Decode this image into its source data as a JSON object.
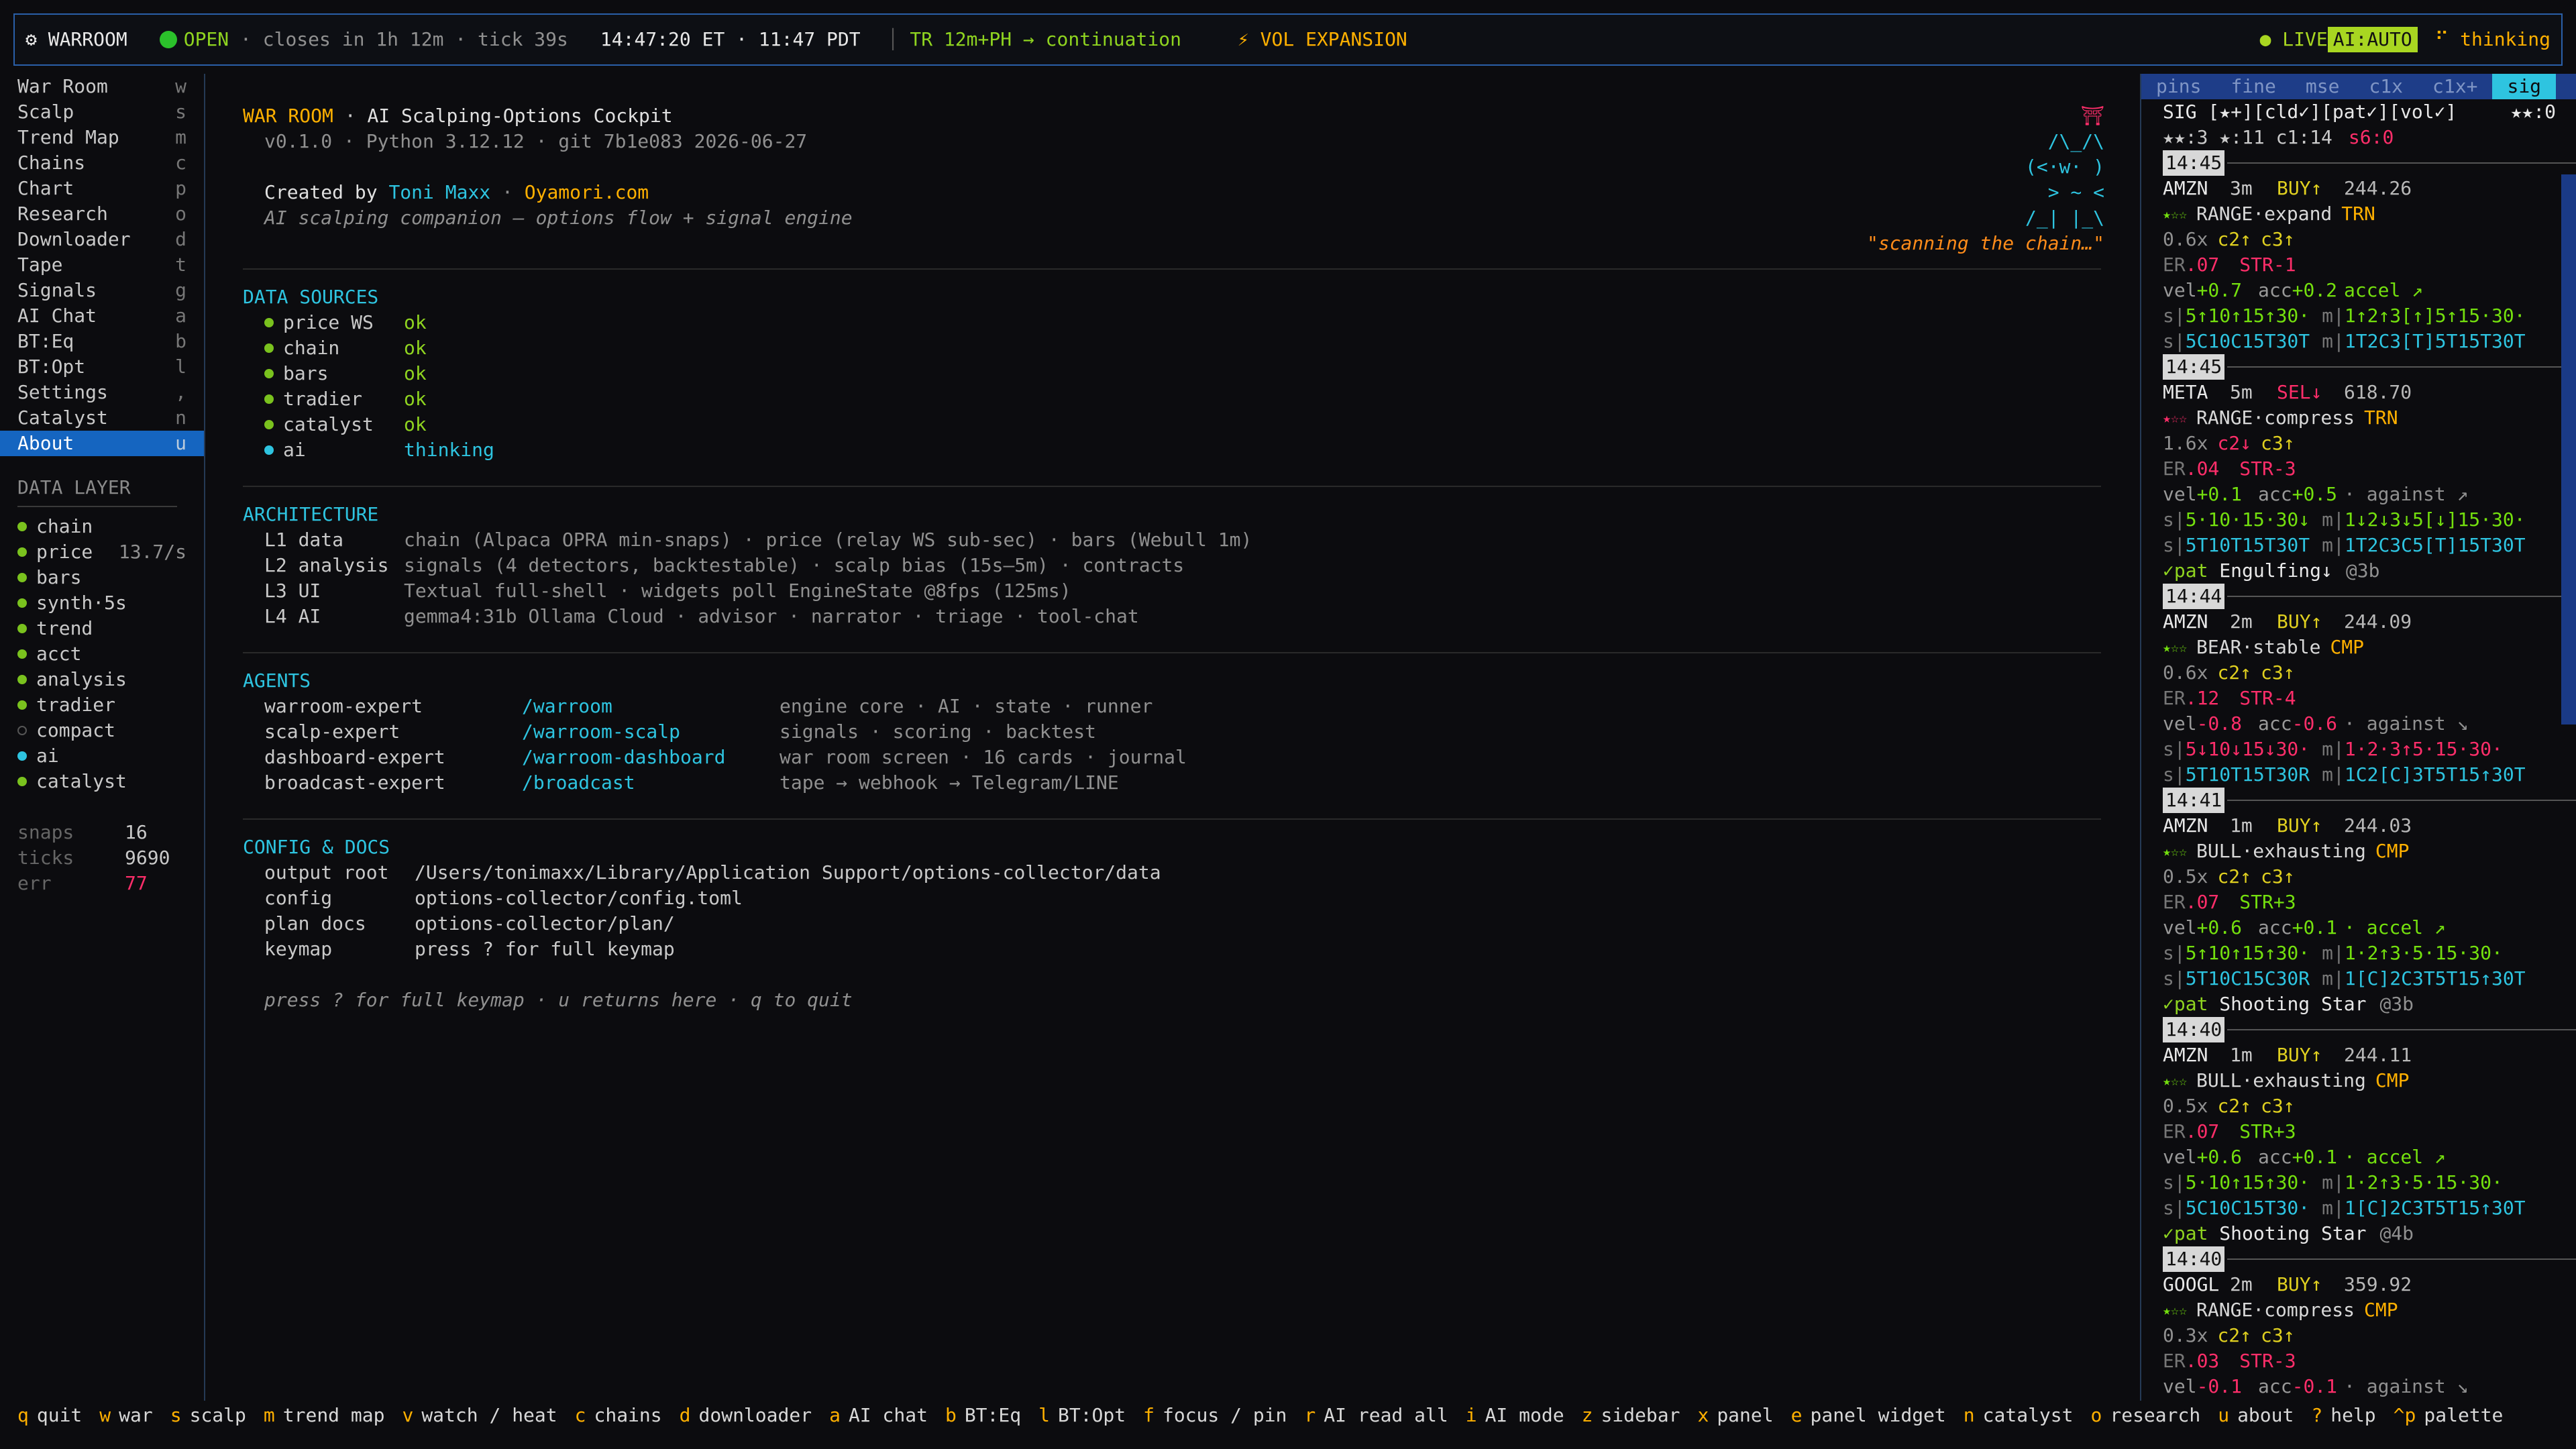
{
  "topbar": {
    "app": "⚙ WARROOM",
    "market_state": "OPEN",
    "closes": " · closes in 1h 12m · tick 39s",
    "time": "14:47:20 ET · 11:47 PDT",
    "trend": "TR 12m+PH → continuation",
    "regime": "⚡ VOL EXPANSION",
    "live": "● LIVE",
    "ai_mode": "AI:AUTO",
    "ai_state": "⠋ thinking"
  },
  "sidebar": {
    "nav": [
      {
        "label": "War Room",
        "key": "w"
      },
      {
        "label": "Scalp",
        "key": "s"
      },
      {
        "label": "Trend Map",
        "key": "m"
      },
      {
        "label": "Chains",
        "key": "c"
      },
      {
        "label": "Chart",
        "key": "p"
      },
      {
        "label": "Research",
        "key": "o"
      },
      {
        "label": "Downloader",
        "key": "d"
      },
      {
        "label": "Tape",
        "key": "t"
      },
      {
        "label": "Signals",
        "key": "g"
      },
      {
        "label": "AI Chat",
        "key": "a"
      },
      {
        "label": "BT:Eq",
        "key": "b"
      },
      {
        "label": "BT:Opt",
        "key": "l"
      },
      {
        "label": "Settings",
        "key": ","
      },
      {
        "label": "Catalyst",
        "key": "n"
      },
      {
        "label": "About",
        "key": "u"
      }
    ],
    "data_layer_title": "DATA LAYER",
    "layers": [
      {
        "label": "chain",
        "rate": ""
      },
      {
        "label": "price",
        "rate": "13.7/s"
      },
      {
        "label": "bars",
        "rate": ""
      },
      {
        "label": "synth·5s",
        "rate": ""
      },
      {
        "label": "trend",
        "rate": ""
      },
      {
        "label": "acct",
        "rate": ""
      },
      {
        "label": "analysis",
        "rate": ""
      },
      {
        "label": "tradier",
        "rate": ""
      },
      {
        "label": "compact",
        "rate": ""
      },
      {
        "label": "ai",
        "rate": ""
      },
      {
        "label": "catalyst",
        "rate": ""
      }
    ],
    "stats": [
      {
        "label": "snaps",
        "value": "16"
      },
      {
        "label": "ticks",
        "value": "9690"
      },
      {
        "label": "err",
        "value": "77"
      }
    ]
  },
  "about": {
    "title": "WAR ROOM",
    "title_sep": " · ",
    "subtitle": "AI Scalping-Options Cockpit",
    "version": "v0.1.0 · Python 3.12.12 · git 7b1e083 2026-06-27",
    "created_by": "Created by ",
    "author": "Toni Maxx",
    "author_sep": " · ",
    "site": "Oyamori.com",
    "tagline": "AI scalping companion — options flow + signal engine",
    "mascot": [
      "⛩",
      "/\\_/\\",
      "(<·w·  )",
      "> ~ <",
      "/_| |_\\"
    ],
    "mascot_caption": "\"scanning the chain…\"",
    "data_sources_title": "DATA SOURCES",
    "data_sources": [
      {
        "name": "price WS",
        "status": "ok"
      },
      {
        "name": "chain",
        "status": "ok"
      },
      {
        "name": "bars",
        "status": "ok"
      },
      {
        "name": "tradier",
        "status": "ok"
      },
      {
        "name": "catalyst",
        "status": "ok"
      },
      {
        "name": "ai",
        "status": "thinking"
      }
    ],
    "architecture_title": "ARCHITECTURE",
    "architecture": [
      {
        "layer": "L1 data",
        "desc": "chain (Alpaca OPRA min-snaps) · price (relay WS sub-sec) · bars (Webull 1m)"
      },
      {
        "layer": "L2 analysis",
        "desc": "signals (4 detectors, backtestable) · scalp bias (15s–5m) · contracts"
      },
      {
        "layer": "L3 UI",
        "desc": "Textual full-shell · widgets poll EngineState @8fps (125ms)"
      },
      {
        "layer": "L4 AI",
        "desc": "gemma4:31b Ollama Cloud · advisor · narrator · triage · tool-chat"
      }
    ],
    "agents_title": "AGENTS",
    "agents": [
      {
        "name": "warroom-expert",
        "cmd": "/warroom",
        "desc": "engine core · AI · state · runner"
      },
      {
        "name": "scalp-expert",
        "cmd": "/warroom-scalp",
        "desc": "signals · scoring · backtest"
      },
      {
        "name": "dashboard-expert",
        "cmd": "/warroom-dashboard",
        "desc": "war room screen · 16 cards · journal"
      },
      {
        "name": "broadcast-expert",
        "cmd": "/broadcast",
        "desc": "tape → webhook → Telegram/LINE"
      }
    ],
    "config_title": "CONFIG & DOCS",
    "config": [
      {
        "label": "output root",
        "value": "/Users/tonimaxx/Library/Application Support/options-collector/data"
      },
      {
        "label": "config",
        "value": "options-collector/config.toml"
      },
      {
        "label": "plan docs",
        "value": "options-collector/plan/"
      },
      {
        "label": "keymap",
        "value": "press ? for full keymap"
      }
    ],
    "footer_hint": "press ? for full keymap · u returns here · q to quit"
  },
  "signals_panel": {
    "tabs": [
      "pins",
      "fine",
      "mse",
      "c1x",
      "c1x+",
      "sig"
    ],
    "active_tab": "sig",
    "header": "SIG [★+][cld✓][pat✓][vol✓]",
    "header_score": "★★:0",
    "stats": "★★:3 ★:11 c1:14",
    "stats_s6": "s6:0",
    "entries": [
      {
        "time": "14:45",
        "sym": "AMZN",
        "tf": "3m",
        "side": "BUY↑",
        "price": "244.26",
        "rating": "★☆☆",
        "regime": "RANGE·expand",
        "tag": "TRN",
        "mult": "0.6x",
        "c2": "c2↑",
        "c3": "c3↑",
        "er": ".07",
        "str": "STR-1",
        "vel": "+0.7",
        "acc": "+0.2",
        "accstate": "accel ↗",
        "s": "5↑10↑15↑30·",
        "m": "1↑2↑3[↑]5↑15·30·",
        "s2": "5C10C15T30T",
        "m2": "1T2C3[T]5T15T30T",
        "pat": "",
        "patage": ""
      },
      {
        "time": "14:45",
        "sym": "META",
        "tf": "5m",
        "side": "SEL↓",
        "price": "618.70",
        "rating": "★☆☆",
        "regime": "RANGE·compress",
        "tag": "TRN",
        "mult": "1.6x",
        "c2": "c2↓",
        "c3": "c3↑",
        "er": ".04",
        "str": "STR-3",
        "vel": "+0.1",
        "acc": "+0.5",
        "accstate": "· against ↗",
        "s": "5·10·15·30↓",
        "m": "1↓2↓3↓5[↓]15·30·",
        "s2": "5T10T15T30T",
        "m2": "1T2C3C5[T]15T30T",
        "pat": "Engulfing↓",
        "patage": "@3b"
      },
      {
        "time": "14:44",
        "sym": "AMZN",
        "tf": "2m",
        "side": "BUY↑",
        "price": "244.09",
        "rating": "★☆☆",
        "regime": "BEAR·stable",
        "tag": "CMP",
        "mult": "0.6x",
        "c2": "c2↑",
        "c3": "c3↑",
        "er": ".12",
        "str": "STR-4",
        "vel": "-0.8",
        "acc": "-0.6",
        "accstate": "· against ↘",
        "s": "5↓10↓15↓30·",
        "m": "1·2·3↑5·15·30·",
        "s2": "5T10T15T30R",
        "m2": "1C2[C]3T5T15↑30T",
        "pat": "",
        "patage": ""
      },
      {
        "time": "14:41",
        "sym": "AMZN",
        "tf": "1m",
        "side": "BUY↑",
        "price": "244.03",
        "rating": "★☆☆",
        "regime": "BULL·exhausting",
        "tag": "CMP",
        "mult": "0.5x",
        "c2": "c2↑",
        "c3": "c3↑",
        "er": ".07",
        "str": "STR+3",
        "vel": "+0.6",
        "acc": "+0.1",
        "accstate": "· accel ↗",
        "s": "5↑10↑15↑30·",
        "m": "1·2↑3·5·15·30·",
        "s2": "5T10C15C30R",
        "m2": "1[C]2C3T5T15↑30T",
        "pat": "Shooting Star",
        "patage": "@3b"
      },
      {
        "time": "14:40",
        "sym": "AMZN",
        "tf": "1m",
        "side": "BUY↑",
        "price": "244.11",
        "rating": "★☆☆",
        "regime": "BULL·exhausting",
        "tag": "CMP",
        "mult": "0.5x",
        "c2": "c2↑",
        "c3": "c3↑",
        "er": ".07",
        "str": "STR+3",
        "vel": "+0.6",
        "acc": "+0.1",
        "accstate": "· accel ↗",
        "s": "5·10↑15↑30·",
        "m": "1·2↑3·5·15·30·",
        "s2": "5C10C15T30·",
        "m2": "1[C]2C3T5T15↑30T",
        "pat": "Shooting Star",
        "patage": "@4b"
      },
      {
        "time": "14:40",
        "sym": "GOOGL",
        "tf": "2m",
        "side": "BUY↑",
        "price": "359.92",
        "rating": "★☆☆",
        "regime": "RANGE·compress",
        "tag": "CMP",
        "mult": "0.3x",
        "c2": "c2↑",
        "c3": "c3↑",
        "er": ".03",
        "str": "STR-3",
        "vel": "-0.1",
        "acc": "-0.1",
        "accstate": "· against ↘",
        "s": "",
        "m": "",
        "s2": "",
        "m2": "",
        "pat": "",
        "patage": ""
      }
    ]
  },
  "bottombar": [
    {
      "key": "q",
      "label": "quit"
    },
    {
      "key": "w",
      "label": "war"
    },
    {
      "key": "s",
      "label": "scalp"
    },
    {
      "key": "m",
      "label": "trend map"
    },
    {
      "key": "v",
      "label": "watch / heat"
    },
    {
      "key": "c",
      "label": "chains"
    },
    {
      "key": "d",
      "label": "downloader"
    },
    {
      "key": "a",
      "label": "AI chat"
    },
    {
      "key": "b",
      "label": "BT:Eq"
    },
    {
      "key": "l",
      "label": "BT:Opt"
    },
    {
      "key": "f",
      "label": "focus / pin"
    },
    {
      "key": "r",
      "label": "AI read all"
    },
    {
      "key": "i",
      "label": "AI mode"
    },
    {
      "key": "z",
      "label": "sidebar"
    },
    {
      "key": "x",
      "label": "panel"
    },
    {
      "key": "e",
      "label": "panel widget"
    },
    {
      "key": "n",
      "label": "catalyst"
    },
    {
      "key": "o",
      "label": "research"
    },
    {
      "key": "u",
      "label": "about"
    },
    {
      "key": "?",
      "label": "help"
    },
    {
      "key": "^p",
      "label": "palette"
    }
  ],
  "colors": {
    "accent": "#2ec4e0",
    "amber": "#ffb000",
    "ok": "#8fd420",
    "active_nav": "#1565c0",
    "err": "#ff2e6a"
  }
}
